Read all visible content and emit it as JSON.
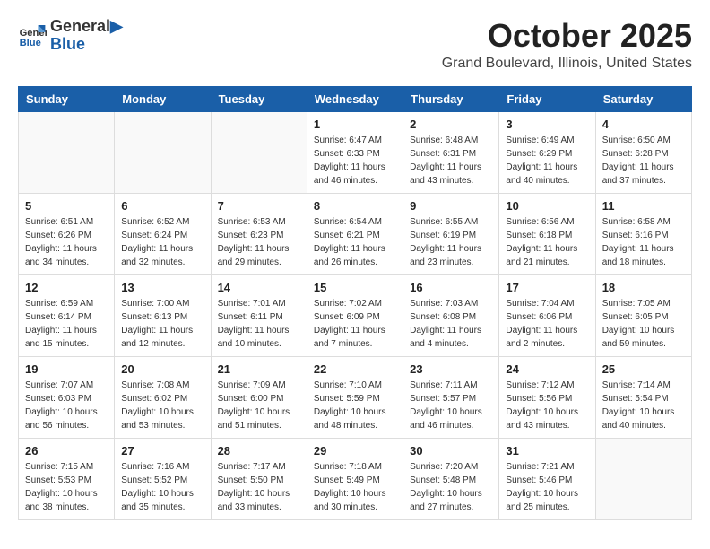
{
  "logo": {
    "line1": "General",
    "line2": "Blue"
  },
  "title": "October 2025",
  "location": "Grand Boulevard, Illinois, United States",
  "weekdays": [
    "Sunday",
    "Monday",
    "Tuesday",
    "Wednesday",
    "Thursday",
    "Friday",
    "Saturday"
  ],
  "weeks": [
    [
      {
        "day": "",
        "info": ""
      },
      {
        "day": "",
        "info": ""
      },
      {
        "day": "",
        "info": ""
      },
      {
        "day": "1",
        "info": "Sunrise: 6:47 AM\nSunset: 6:33 PM\nDaylight: 11 hours and 46 minutes."
      },
      {
        "day": "2",
        "info": "Sunrise: 6:48 AM\nSunset: 6:31 PM\nDaylight: 11 hours and 43 minutes."
      },
      {
        "day": "3",
        "info": "Sunrise: 6:49 AM\nSunset: 6:29 PM\nDaylight: 11 hours and 40 minutes."
      },
      {
        "day": "4",
        "info": "Sunrise: 6:50 AM\nSunset: 6:28 PM\nDaylight: 11 hours and 37 minutes."
      }
    ],
    [
      {
        "day": "5",
        "info": "Sunrise: 6:51 AM\nSunset: 6:26 PM\nDaylight: 11 hours and 34 minutes."
      },
      {
        "day": "6",
        "info": "Sunrise: 6:52 AM\nSunset: 6:24 PM\nDaylight: 11 hours and 32 minutes."
      },
      {
        "day": "7",
        "info": "Sunrise: 6:53 AM\nSunset: 6:23 PM\nDaylight: 11 hours and 29 minutes."
      },
      {
        "day": "8",
        "info": "Sunrise: 6:54 AM\nSunset: 6:21 PM\nDaylight: 11 hours and 26 minutes."
      },
      {
        "day": "9",
        "info": "Sunrise: 6:55 AM\nSunset: 6:19 PM\nDaylight: 11 hours and 23 minutes."
      },
      {
        "day": "10",
        "info": "Sunrise: 6:56 AM\nSunset: 6:18 PM\nDaylight: 11 hours and 21 minutes."
      },
      {
        "day": "11",
        "info": "Sunrise: 6:58 AM\nSunset: 6:16 PM\nDaylight: 11 hours and 18 minutes."
      }
    ],
    [
      {
        "day": "12",
        "info": "Sunrise: 6:59 AM\nSunset: 6:14 PM\nDaylight: 11 hours and 15 minutes."
      },
      {
        "day": "13",
        "info": "Sunrise: 7:00 AM\nSunset: 6:13 PM\nDaylight: 11 hours and 12 minutes."
      },
      {
        "day": "14",
        "info": "Sunrise: 7:01 AM\nSunset: 6:11 PM\nDaylight: 11 hours and 10 minutes."
      },
      {
        "day": "15",
        "info": "Sunrise: 7:02 AM\nSunset: 6:09 PM\nDaylight: 11 hours and 7 minutes."
      },
      {
        "day": "16",
        "info": "Sunrise: 7:03 AM\nSunset: 6:08 PM\nDaylight: 11 hours and 4 minutes."
      },
      {
        "day": "17",
        "info": "Sunrise: 7:04 AM\nSunset: 6:06 PM\nDaylight: 11 hours and 2 minutes."
      },
      {
        "day": "18",
        "info": "Sunrise: 7:05 AM\nSunset: 6:05 PM\nDaylight: 10 hours and 59 minutes."
      }
    ],
    [
      {
        "day": "19",
        "info": "Sunrise: 7:07 AM\nSunset: 6:03 PM\nDaylight: 10 hours and 56 minutes."
      },
      {
        "day": "20",
        "info": "Sunrise: 7:08 AM\nSunset: 6:02 PM\nDaylight: 10 hours and 53 minutes."
      },
      {
        "day": "21",
        "info": "Sunrise: 7:09 AM\nSunset: 6:00 PM\nDaylight: 10 hours and 51 minutes."
      },
      {
        "day": "22",
        "info": "Sunrise: 7:10 AM\nSunset: 5:59 PM\nDaylight: 10 hours and 48 minutes."
      },
      {
        "day": "23",
        "info": "Sunrise: 7:11 AM\nSunset: 5:57 PM\nDaylight: 10 hours and 46 minutes."
      },
      {
        "day": "24",
        "info": "Sunrise: 7:12 AM\nSunset: 5:56 PM\nDaylight: 10 hours and 43 minutes."
      },
      {
        "day": "25",
        "info": "Sunrise: 7:14 AM\nSunset: 5:54 PM\nDaylight: 10 hours and 40 minutes."
      }
    ],
    [
      {
        "day": "26",
        "info": "Sunrise: 7:15 AM\nSunset: 5:53 PM\nDaylight: 10 hours and 38 minutes."
      },
      {
        "day": "27",
        "info": "Sunrise: 7:16 AM\nSunset: 5:52 PM\nDaylight: 10 hours and 35 minutes."
      },
      {
        "day": "28",
        "info": "Sunrise: 7:17 AM\nSunset: 5:50 PM\nDaylight: 10 hours and 33 minutes."
      },
      {
        "day": "29",
        "info": "Sunrise: 7:18 AM\nSunset: 5:49 PM\nDaylight: 10 hours and 30 minutes."
      },
      {
        "day": "30",
        "info": "Sunrise: 7:20 AM\nSunset: 5:48 PM\nDaylight: 10 hours and 27 minutes."
      },
      {
        "day": "31",
        "info": "Sunrise: 7:21 AM\nSunset: 5:46 PM\nDaylight: 10 hours and 25 minutes."
      },
      {
        "day": "",
        "info": ""
      }
    ]
  ]
}
